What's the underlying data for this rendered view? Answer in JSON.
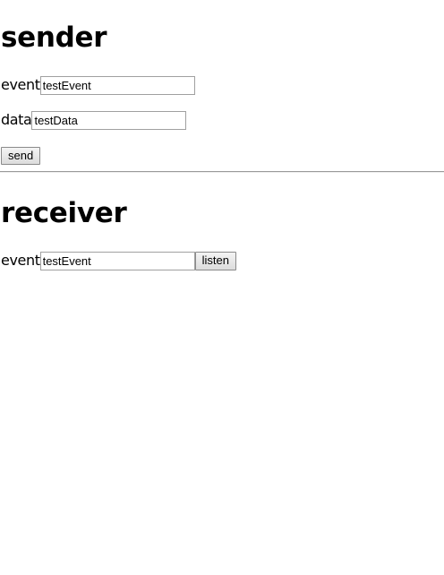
{
  "sender": {
    "heading": "sender",
    "event_label": "event",
    "event_value": "testEvent",
    "data_label": "data",
    "data_value": "testData",
    "send_label": "send"
  },
  "receiver": {
    "heading": "receiver",
    "event_label": "event",
    "event_value": "testEvent",
    "listen_label": "listen"
  }
}
